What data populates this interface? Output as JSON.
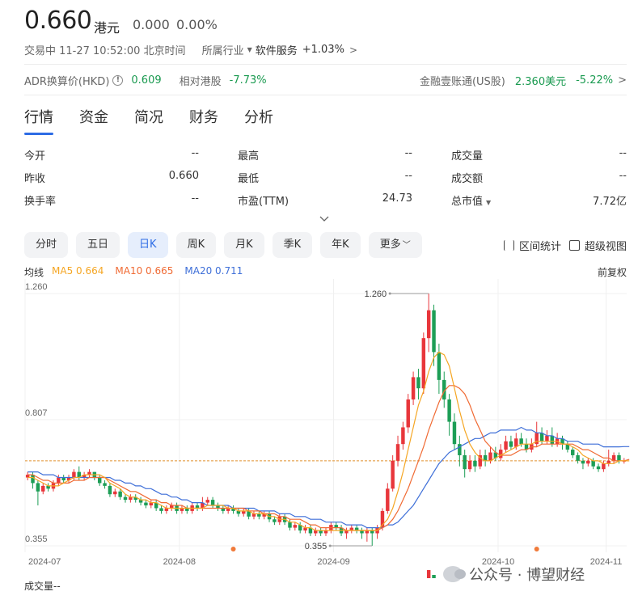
{
  "header": {
    "price": "0.660",
    "currency": "港元",
    "change": "0.000",
    "change_pct": "0.00%",
    "status_time": "交易中 11-27 10:52:00 北京时间",
    "industry_label": "所属行业",
    "industry_name": "软件服务",
    "industry_pct": "+1.03%"
  },
  "adr": {
    "label": "ADR换算价(HKD)",
    "value": "0.609",
    "relative_label": "相对港股",
    "relative_value": "-7.73%",
    "fin_label": "金融壹账通(US股)",
    "fin_value": "2.360美元",
    "fin_pct": "-5.22%"
  },
  "tabs": [
    "行情",
    "资金",
    "简况",
    "财务",
    "分析"
  ],
  "stats": [
    [
      {
        "label": "今开",
        "value": "--"
      },
      {
        "label": "最高",
        "value": "--"
      },
      {
        "label": "成交量",
        "value": "--"
      }
    ],
    [
      {
        "label": "昨收",
        "value": "0.660"
      },
      {
        "label": "最低",
        "value": "--"
      },
      {
        "label": "成交额",
        "value": "--"
      }
    ],
    [
      {
        "label": "换手率",
        "value": "--"
      },
      {
        "label": "市盈(TTM)",
        "value": "24.73"
      },
      {
        "label": "总市值",
        "value": "7.72亿"
      }
    ]
  ],
  "periods": [
    "分时",
    "五日",
    "日K",
    "周K",
    "月K",
    "季K",
    "年K",
    "更多"
  ],
  "active_period": "日K",
  "tools": {
    "range": "区间统计",
    "super": "超级视图"
  },
  "ma": {
    "label": "均线",
    "ma5": "MA5 0.664",
    "ma10": "MA10 0.665",
    "ma20": "MA20 0.711"
  },
  "adjust": "前复权",
  "volume_label": "成交量--",
  "watermark": "公众号 · 博望财经",
  "colors": {
    "up": "#e8363b",
    "down": "#1d9e56",
    "accent": "#2d6ce5",
    "ma5": "#f5a623",
    "ma10": "#f06a33",
    "ma20": "#3e6fd8"
  },
  "chart_data": {
    "type": "candlestick",
    "y_ticks": [
      "1.260",
      "0.807",
      "0.355"
    ],
    "x_ticks": [
      "2024-07",
      "2024-08",
      "2024-09",
      "2024-10",
      "2024-11"
    ],
    "ylim": [
      0.355,
      1.26
    ],
    "last_close": 0.66,
    "annotations": {
      "high": "1.260",
      "low": "0.355"
    },
    "candles": [
      [
        0.6,
        0.61,
        0.62,
        0.59
      ],
      [
        0.61,
        0.58,
        0.62,
        0.56
      ],
      [
        0.58,
        0.55,
        0.59,
        0.5
      ],
      [
        0.55,
        0.57,
        0.58,
        0.54
      ],
      [
        0.57,
        0.56,
        0.58,
        0.55
      ],
      [
        0.56,
        0.58,
        0.59,
        0.55
      ],
      [
        0.58,
        0.6,
        0.61,
        0.57
      ],
      [
        0.6,
        0.59,
        0.61,
        0.58
      ],
      [
        0.59,
        0.6,
        0.61,
        0.58
      ],
      [
        0.6,
        0.62,
        0.63,
        0.59
      ],
      [
        0.62,
        0.6,
        0.64,
        0.59
      ],
      [
        0.6,
        0.61,
        0.62,
        0.59
      ],
      [
        0.61,
        0.62,
        0.63,
        0.6
      ],
      [
        0.62,
        0.6,
        0.62,
        0.59
      ],
      [
        0.6,
        0.58,
        0.61,
        0.57
      ],
      [
        0.58,
        0.57,
        0.59,
        0.56
      ],
      [
        0.57,
        0.54,
        0.58,
        0.53
      ],
      [
        0.54,
        0.55,
        0.56,
        0.53
      ],
      [
        0.55,
        0.53,
        0.56,
        0.52
      ],
      [
        0.53,
        0.52,
        0.54,
        0.51
      ],
      [
        0.52,
        0.53,
        0.54,
        0.51
      ],
      [
        0.53,
        0.52,
        0.54,
        0.51
      ],
      [
        0.52,
        0.51,
        0.53,
        0.5
      ],
      [
        0.51,
        0.5,
        0.52,
        0.49
      ],
      [
        0.5,
        0.51,
        0.52,
        0.49
      ],
      [
        0.51,
        0.49,
        0.52,
        0.48
      ],
      [
        0.49,
        0.48,
        0.5,
        0.47
      ],
      [
        0.48,
        0.49,
        0.5,
        0.47
      ],
      [
        0.49,
        0.5,
        0.51,
        0.48
      ],
      [
        0.5,
        0.48,
        0.51,
        0.47
      ],
      [
        0.48,
        0.49,
        0.5,
        0.47
      ],
      [
        0.49,
        0.48,
        0.5,
        0.47
      ],
      [
        0.48,
        0.5,
        0.51,
        0.47
      ],
      [
        0.5,
        0.49,
        0.51,
        0.48
      ],
      [
        0.49,
        0.51,
        0.53,
        0.48
      ],
      [
        0.51,
        0.52,
        0.53,
        0.5
      ],
      [
        0.52,
        0.5,
        0.53,
        0.49
      ],
      [
        0.5,
        0.49,
        0.51,
        0.48
      ],
      [
        0.49,
        0.48,
        0.5,
        0.47
      ],
      [
        0.48,
        0.49,
        0.5,
        0.47
      ],
      [
        0.49,
        0.48,
        0.5,
        0.47
      ],
      [
        0.48,
        0.47,
        0.49,
        0.46
      ],
      [
        0.47,
        0.48,
        0.49,
        0.46
      ],
      [
        0.48,
        0.46,
        0.49,
        0.45
      ],
      [
        0.46,
        0.47,
        0.48,
        0.45
      ],
      [
        0.47,
        0.46,
        0.48,
        0.45
      ],
      [
        0.46,
        0.47,
        0.48,
        0.45
      ],
      [
        0.47,
        0.45,
        0.48,
        0.44
      ],
      [
        0.45,
        0.44,
        0.46,
        0.43
      ],
      [
        0.44,
        0.46,
        0.47,
        0.43
      ],
      [
        0.46,
        0.44,
        0.47,
        0.43
      ],
      [
        0.44,
        0.42,
        0.45,
        0.41
      ],
      [
        0.42,
        0.43,
        0.44,
        0.41
      ],
      [
        0.43,
        0.41,
        0.44,
        0.4
      ],
      [
        0.41,
        0.42,
        0.43,
        0.4
      ],
      [
        0.42,
        0.4,
        0.43,
        0.39
      ],
      [
        0.4,
        0.41,
        0.42,
        0.39
      ],
      [
        0.41,
        0.4,
        0.42,
        0.39
      ],
      [
        0.4,
        0.41,
        0.42,
        0.39
      ],
      [
        0.41,
        0.43,
        0.44,
        0.4
      ],
      [
        0.43,
        0.42,
        0.44,
        0.41
      ],
      [
        0.42,
        0.4,
        0.43,
        0.39
      ],
      [
        0.4,
        0.41,
        0.42,
        0.38
      ],
      [
        0.41,
        0.42,
        0.43,
        0.4
      ],
      [
        0.42,
        0.41,
        0.43,
        0.4
      ],
      [
        0.41,
        0.4,
        0.42,
        0.38
      ],
      [
        0.4,
        0.41,
        0.42,
        0.37
      ],
      [
        0.41,
        0.4,
        0.42,
        0.355
      ],
      [
        0.4,
        0.42,
        0.43,
        0.38
      ],
      [
        0.42,
        0.48,
        0.49,
        0.41
      ],
      [
        0.48,
        0.56,
        0.58,
        0.47
      ],
      [
        0.56,
        0.66,
        0.68,
        0.55
      ],
      [
        0.66,
        0.72,
        0.75,
        0.64
      ],
      [
        0.72,
        0.78,
        0.8,
        0.7
      ],
      [
        0.78,
        0.88,
        0.9,
        0.76
      ],
      [
        0.88,
        0.96,
        0.98,
        0.86
      ],
      [
        0.96,
        0.92,
        0.99,
        0.88
      ],
      [
        0.92,
        1.1,
        1.12,
        0.9
      ],
      [
        1.1,
        1.2,
        1.26,
        1.05
      ],
      [
        1.2,
        1.05,
        1.22,
        1.0
      ],
      [
        1.05,
        0.95,
        1.08,
        0.9
      ],
      [
        0.95,
        0.88,
        0.98,
        0.85
      ],
      [
        0.88,
        0.8,
        0.9,
        0.75
      ],
      [
        0.8,
        0.72,
        0.83,
        0.7
      ],
      [
        0.72,
        0.68,
        0.75,
        0.64
      ],
      [
        0.68,
        0.63,
        0.7,
        0.6
      ],
      [
        0.63,
        0.66,
        0.68,
        0.62
      ],
      [
        0.66,
        0.64,
        0.68,
        0.62
      ],
      [
        0.64,
        0.68,
        0.7,
        0.63
      ],
      [
        0.68,
        0.66,
        0.7,
        0.64
      ],
      [
        0.66,
        0.69,
        0.71,
        0.65
      ],
      [
        0.69,
        0.67,
        0.71,
        0.66
      ],
      [
        0.67,
        0.7,
        0.72,
        0.66
      ],
      [
        0.7,
        0.73,
        0.75,
        0.69
      ],
      [
        0.73,
        0.71,
        0.75,
        0.7
      ],
      [
        0.71,
        0.74,
        0.76,
        0.7
      ],
      [
        0.74,
        0.72,
        0.76,
        0.71
      ],
      [
        0.72,
        0.7,
        0.74,
        0.69
      ],
      [
        0.7,
        0.72,
        0.74,
        0.69
      ],
      [
        0.72,
        0.76,
        0.8,
        0.71
      ],
      [
        0.76,
        0.73,
        0.78,
        0.72
      ],
      [
        0.73,
        0.75,
        0.77,
        0.72
      ],
      [
        0.75,
        0.72,
        0.78,
        0.71
      ],
      [
        0.72,
        0.74,
        0.76,
        0.71
      ],
      [
        0.74,
        0.72,
        0.75,
        0.7
      ],
      [
        0.72,
        0.7,
        0.73,
        0.69
      ],
      [
        0.7,
        0.68,
        0.71,
        0.67
      ],
      [
        0.68,
        0.66,
        0.69,
        0.65
      ],
      [
        0.66,
        0.65,
        0.67,
        0.63
      ],
      [
        0.65,
        0.66,
        0.67,
        0.64
      ],
      [
        0.66,
        0.64,
        0.67,
        0.63
      ],
      [
        0.64,
        0.63,
        0.65,
        0.62
      ],
      [
        0.63,
        0.65,
        0.66,
        0.62
      ],
      [
        0.65,
        0.66,
        0.7,
        0.64
      ],
      [
        0.66,
        0.68,
        0.69,
        0.65
      ],
      [
        0.68,
        0.66,
        0.69,
        0.65
      ],
      [
        0.66,
        0.66,
        0.67,
        0.65
      ]
    ],
    "ma5": [
      0.6,
      0.6,
      0.59,
      0.58,
      0.57,
      0.57,
      0.57,
      0.58,
      0.59,
      0.6,
      0.6,
      0.61,
      0.61,
      0.61,
      0.61,
      0.6,
      0.58,
      0.57,
      0.56,
      0.54,
      0.53,
      0.53,
      0.52,
      0.52,
      0.51,
      0.51,
      0.5,
      0.49,
      0.49,
      0.49,
      0.49,
      0.49,
      0.49,
      0.49,
      0.49,
      0.5,
      0.5,
      0.5,
      0.5,
      0.49,
      0.49,
      0.48,
      0.48,
      0.48,
      0.47,
      0.47,
      0.47,
      0.46,
      0.46,
      0.45,
      0.45,
      0.44,
      0.44,
      0.43,
      0.42,
      0.42,
      0.41,
      0.41,
      0.41,
      0.41,
      0.41,
      0.41,
      0.41,
      0.41,
      0.41,
      0.41,
      0.41,
      0.41,
      0.41,
      0.43,
      0.45,
      0.49,
      0.55,
      0.62,
      0.7,
      0.78,
      0.86,
      0.91,
      0.98,
      1.03,
      1.05,
      1.04,
      1.0,
      0.92,
      0.84,
      0.77,
      0.72,
      0.69,
      0.67,
      0.66,
      0.66,
      0.67,
      0.68,
      0.69,
      0.7,
      0.71,
      0.72,
      0.72,
      0.72,
      0.73,
      0.73,
      0.73,
      0.73,
      0.73,
      0.72,
      0.72,
      0.71,
      0.7,
      0.68,
      0.67,
      0.66,
      0.66,
      0.65,
      0.65,
      0.65,
      0.66,
      0.66,
      0.66
    ],
    "ma10": [
      0.61,
      0.61,
      0.6,
      0.59,
      0.59,
      0.58,
      0.58,
      0.58,
      0.58,
      0.59,
      0.59,
      0.59,
      0.6,
      0.6,
      0.6,
      0.6,
      0.59,
      0.58,
      0.57,
      0.56,
      0.55,
      0.55,
      0.54,
      0.53,
      0.52,
      0.52,
      0.51,
      0.51,
      0.5,
      0.5,
      0.5,
      0.49,
      0.49,
      0.49,
      0.49,
      0.49,
      0.49,
      0.49,
      0.49,
      0.49,
      0.49,
      0.49,
      0.49,
      0.48,
      0.48,
      0.48,
      0.47,
      0.47,
      0.47,
      0.46,
      0.46,
      0.45,
      0.45,
      0.45,
      0.44,
      0.43,
      0.43,
      0.42,
      0.42,
      0.42,
      0.42,
      0.42,
      0.41,
      0.41,
      0.41,
      0.41,
      0.41,
      0.41,
      0.41,
      0.42,
      0.43,
      0.45,
      0.48,
      0.52,
      0.56,
      0.61,
      0.66,
      0.71,
      0.77,
      0.82,
      0.87,
      0.91,
      0.93,
      0.93,
      0.92,
      0.9,
      0.86,
      0.81,
      0.77,
      0.73,
      0.71,
      0.69,
      0.68,
      0.68,
      0.68,
      0.69,
      0.7,
      0.7,
      0.71,
      0.71,
      0.72,
      0.72,
      0.72,
      0.72,
      0.72,
      0.72,
      0.72,
      0.71,
      0.7,
      0.7,
      0.69,
      0.68,
      0.67,
      0.67,
      0.66,
      0.66,
      0.66,
      0.665
    ],
    "ma20": [
      0.62,
      0.62,
      0.62,
      0.61,
      0.61,
      0.61,
      0.6,
      0.6,
      0.6,
      0.6,
      0.6,
      0.6,
      0.6,
      0.6,
      0.6,
      0.6,
      0.6,
      0.59,
      0.59,
      0.58,
      0.58,
      0.57,
      0.57,
      0.56,
      0.56,
      0.55,
      0.54,
      0.54,
      0.53,
      0.53,
      0.52,
      0.52,
      0.51,
      0.51,
      0.51,
      0.5,
      0.5,
      0.5,
      0.5,
      0.5,
      0.49,
      0.49,
      0.49,
      0.49,
      0.49,
      0.48,
      0.48,
      0.48,
      0.48,
      0.47,
      0.47,
      0.47,
      0.46,
      0.46,
      0.46,
      0.45,
      0.45,
      0.45,
      0.44,
      0.44,
      0.44,
      0.44,
      0.43,
      0.43,
      0.43,
      0.43,
      0.42,
      0.42,
      0.42,
      0.42,
      0.43,
      0.43,
      0.44,
      0.46,
      0.48,
      0.5,
      0.53,
      0.56,
      0.59,
      0.62,
      0.65,
      0.67,
      0.69,
      0.7,
      0.71,
      0.72,
      0.73,
      0.74,
      0.74,
      0.75,
      0.76,
      0.76,
      0.77,
      0.77,
      0.77,
      0.77,
      0.78,
      0.77,
      0.77,
      0.76,
      0.76,
      0.75,
      0.75,
      0.74,
      0.74,
      0.73,
      0.73,
      0.73,
      0.72,
      0.72,
      0.72,
      0.72,
      0.71,
      0.71,
      0.71,
      0.71,
      0.711,
      0.711
    ]
  }
}
